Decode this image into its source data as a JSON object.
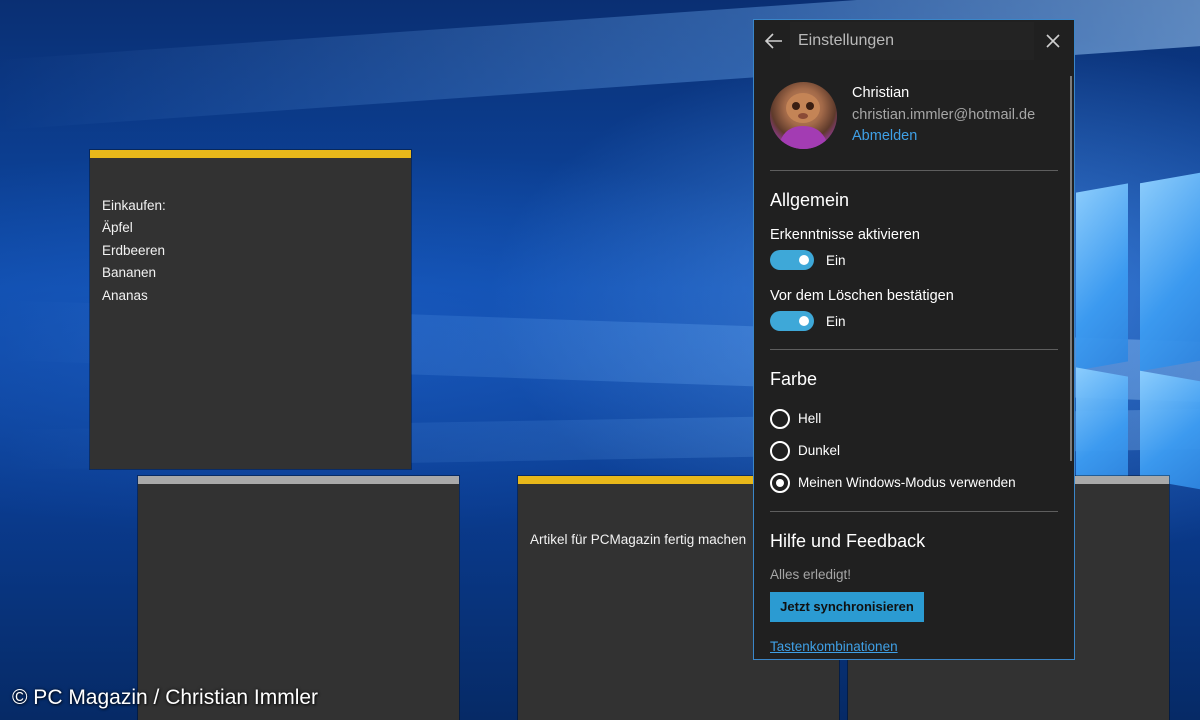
{
  "colors": {
    "note_accent_yellow": "#e8b81a",
    "note_accent_grey": "#a9a9a9",
    "note_background": "#323232",
    "panel_background": "#202020",
    "accent_blue": "#3ea8d8",
    "link_blue": "#3fa0e6"
  },
  "notes": [
    {
      "accent": "yellow",
      "lines": [
        "",
        "Einkaufen:",
        "Äpfel",
        "Erdbeeren",
        "Bananen",
        "Ananas"
      ]
    },
    {
      "accent": "grey",
      "lines": []
    },
    {
      "accent": "yellow",
      "lines": [
        "Artikel für PCMagazin fertig machen"
      ]
    },
    {
      "accent": "grey",
      "lines": []
    }
  ],
  "settings": {
    "title": "Einstellungen",
    "back_icon": "arrow-left-icon",
    "close_icon": "close-icon",
    "account": {
      "name": "Christian",
      "email": "christian.immler@hotmail.de",
      "signout": "Abmelden"
    },
    "general": {
      "heading": "Allgemein",
      "insights": {
        "label": "Erkenntnisse aktivieren",
        "state": "Ein",
        "on": true
      },
      "confirm_delete": {
        "label": "Vor dem Löschen bestätigen",
        "state": "Ein",
        "on": true
      }
    },
    "color": {
      "heading": "Farbe",
      "options": [
        {
          "label": "Hell",
          "selected": false
        },
        {
          "label": "Dunkel",
          "selected": false
        },
        {
          "label": "Meinen Windows-Modus verwenden",
          "selected": true
        }
      ]
    },
    "help": {
      "heading": "Hilfe und Feedback",
      "status": "Alles erledigt!",
      "sync_button": "Jetzt synchronisieren",
      "shortcuts_link": "Tastenkombinationen"
    }
  },
  "watermark": "© PC Magazin / Christian Immler"
}
